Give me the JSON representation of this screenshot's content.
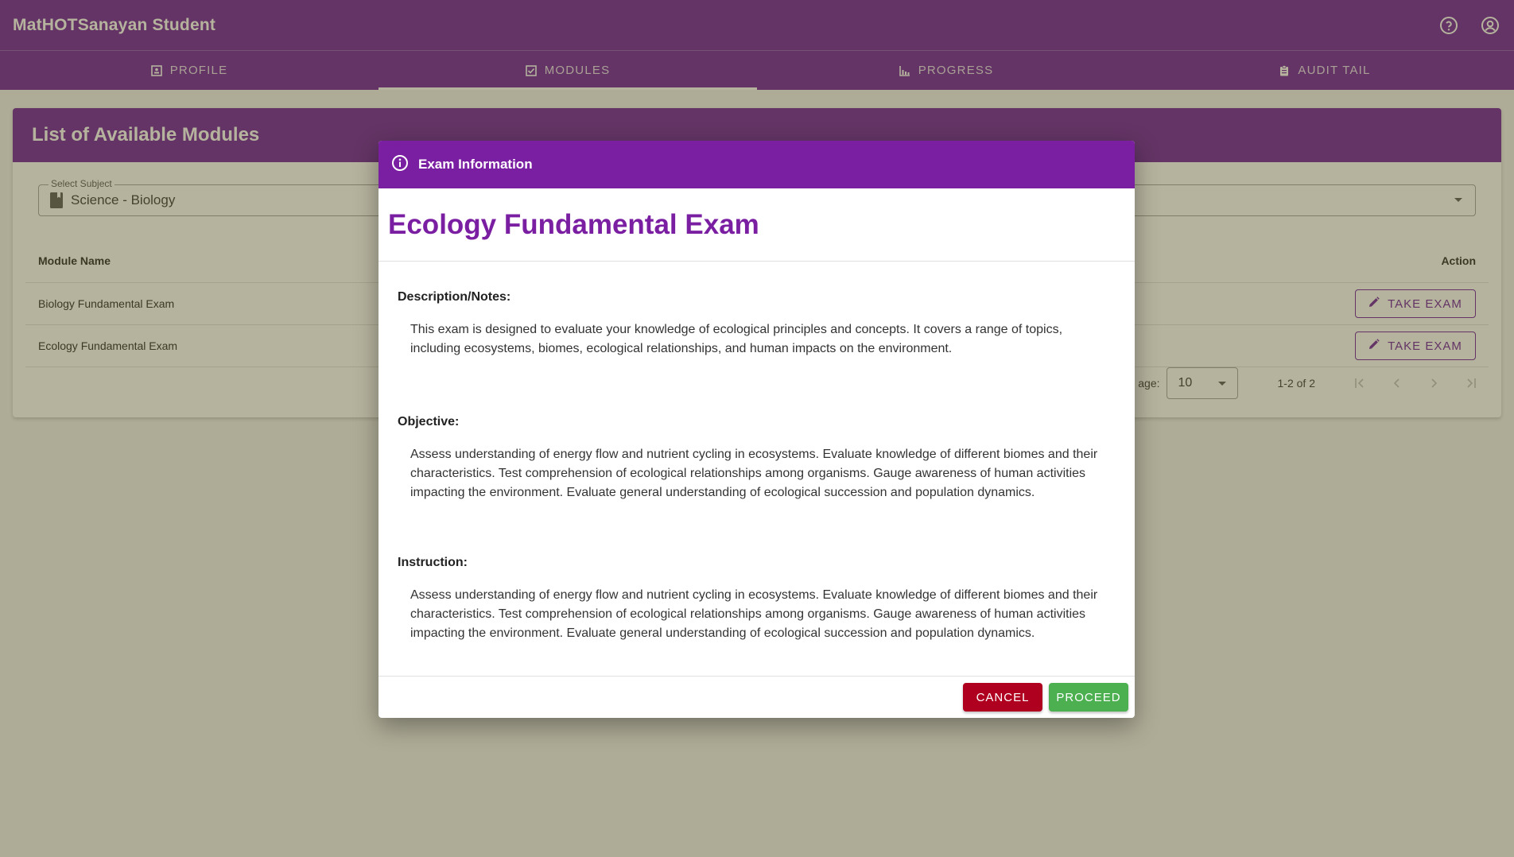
{
  "app": {
    "title": "MatHOTSanayan Student",
    "icons": [
      "help-icon",
      "account-icon"
    ]
  },
  "tabs": [
    {
      "label": "PROFILE",
      "icon": "profile-icon",
      "active": false
    },
    {
      "label": "MODULES",
      "icon": "checkbox-icon",
      "active": true
    },
    {
      "label": "PROGRESS",
      "icon": "bar-chart-icon",
      "active": false
    },
    {
      "label": "AUDIT TAIL",
      "icon": "clipboard-icon",
      "active": false
    }
  ],
  "card": {
    "title": "List of Available Modules",
    "subject": {
      "legend": "Select Subject",
      "value": "Science - Biology"
    },
    "table": {
      "headers": {
        "name": "Module Name",
        "action": "Action"
      },
      "rows": [
        {
          "name": "Biology Fundamental Exam",
          "action": "TAKE EXAM"
        },
        {
          "name": "Ecology Fundamental Exam",
          "action": "TAKE EXAM"
        }
      ]
    },
    "pagination": {
      "label": "age:",
      "per_page": "10",
      "range": "1-2 of 2"
    }
  },
  "dialog": {
    "header": "Exam Information",
    "title": "Ecology Fundamental Exam",
    "description_label": "Description/Notes:",
    "description_line1": "This exam is designed to evaluate your knowledge of ecological principles and concepts. It covers a range of topics,",
    "description_line2": "including ecosystems, biomes, ecological relationships, and human impacts on the environment.",
    "objective_label": "Objective:",
    "objective_line1": "Assess understanding of energy flow and nutrient cycling in ecosystems. Evaluate knowledge of different biomes and their",
    "objective_line2": "characteristics. Test comprehension of ecological relationships among organisms. Gauge awareness of human activities",
    "objective_line3": "impacting the environment. Evaluate general understanding of ecological succession and population dynamics.",
    "instruction_label": "Instruction:",
    "instruction_line1": "Assess understanding of energy flow and nutrient cycling in ecosystems. Evaluate knowledge of different biomes and their",
    "instruction_line2": "characteristics. Test comprehension of ecological relationships among organisms. Gauge awareness of human activities",
    "instruction_line3": "impacting the environment. Evaluate general understanding of ecological succession and population dynamics.",
    "cancel_label": "CANCEL",
    "proceed_label": "PROCEED"
  },
  "colors": {
    "primary": "#6a1b9a",
    "dialog_header": "#7b1fa2",
    "cancel": "#b00020",
    "proceed": "#4caf50"
  }
}
